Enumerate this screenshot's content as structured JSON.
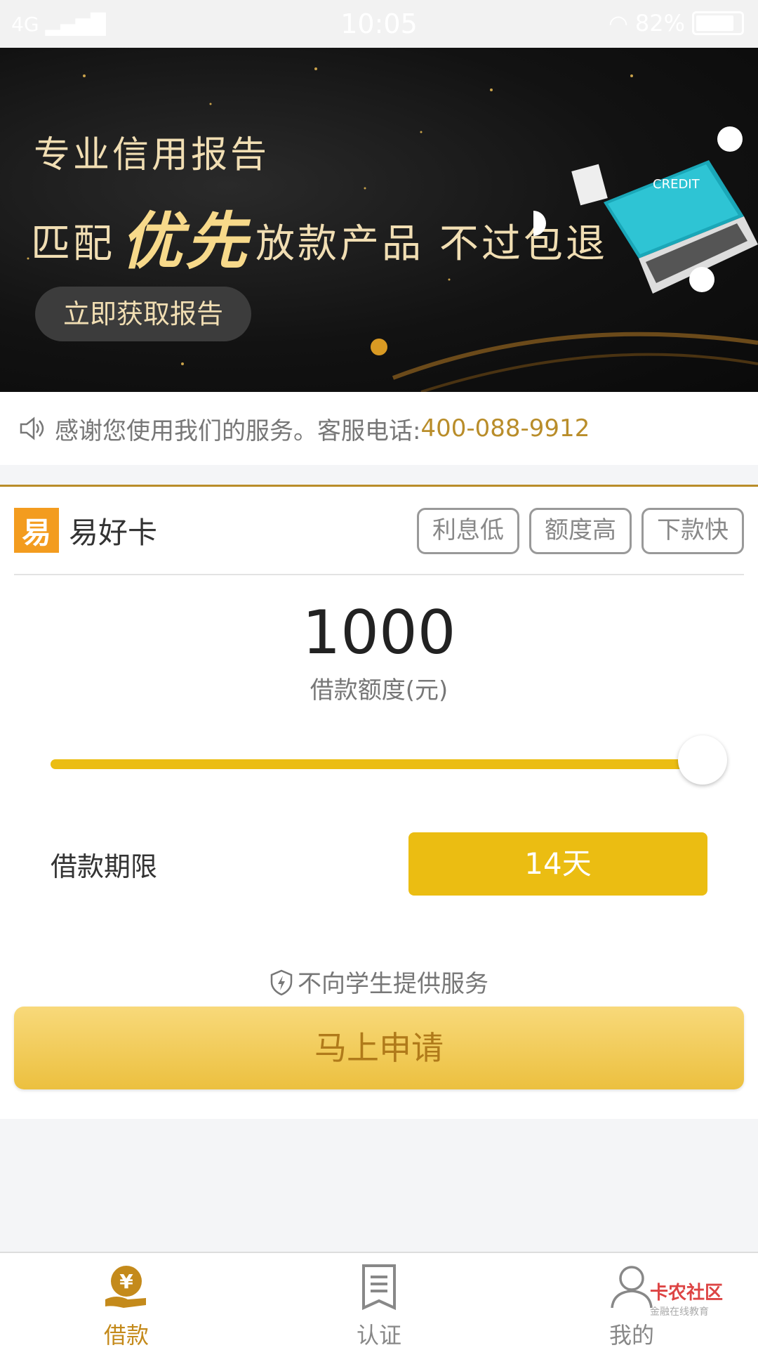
{
  "status": {
    "network": "4G",
    "time": "10:05",
    "battery": "82%"
  },
  "banner": {
    "line1": "专业信用报告",
    "line2_prefix": "匹配",
    "line2_highlight": "优先",
    "line2_suffix": "放款产品 不过包退",
    "cta": "立即获取报告",
    "illustration_text": "CREDIT"
  },
  "notice": {
    "text": "感谢您使用我们的服务。客服电话:",
    "phone": "400-088-9912"
  },
  "product": {
    "logo_char": "易",
    "name": "易好卡",
    "tags": [
      "利息低",
      "额度高",
      "下款快"
    ]
  },
  "loan": {
    "amount": "1000",
    "amount_label": "借款额度(元)",
    "slider_value_fraction": 1.0,
    "term_label": "借款期限",
    "term_value": "14天",
    "student_notice": "不向学生提供服务",
    "apply_button": "马上申请"
  },
  "tabs": [
    {
      "label": "借款",
      "icon": "loan-icon",
      "active": true
    },
    {
      "label": "认证",
      "icon": "document-icon",
      "active": false
    },
    {
      "label": "我的",
      "icon": "user-icon",
      "active": false
    }
  ],
  "watermark": {
    "title": "卡农社区",
    "subtitle": "金融在线教育"
  },
  "colors": {
    "accent": "#ebbd12",
    "brand": "#f39c1f",
    "link": "#b98d2a"
  }
}
